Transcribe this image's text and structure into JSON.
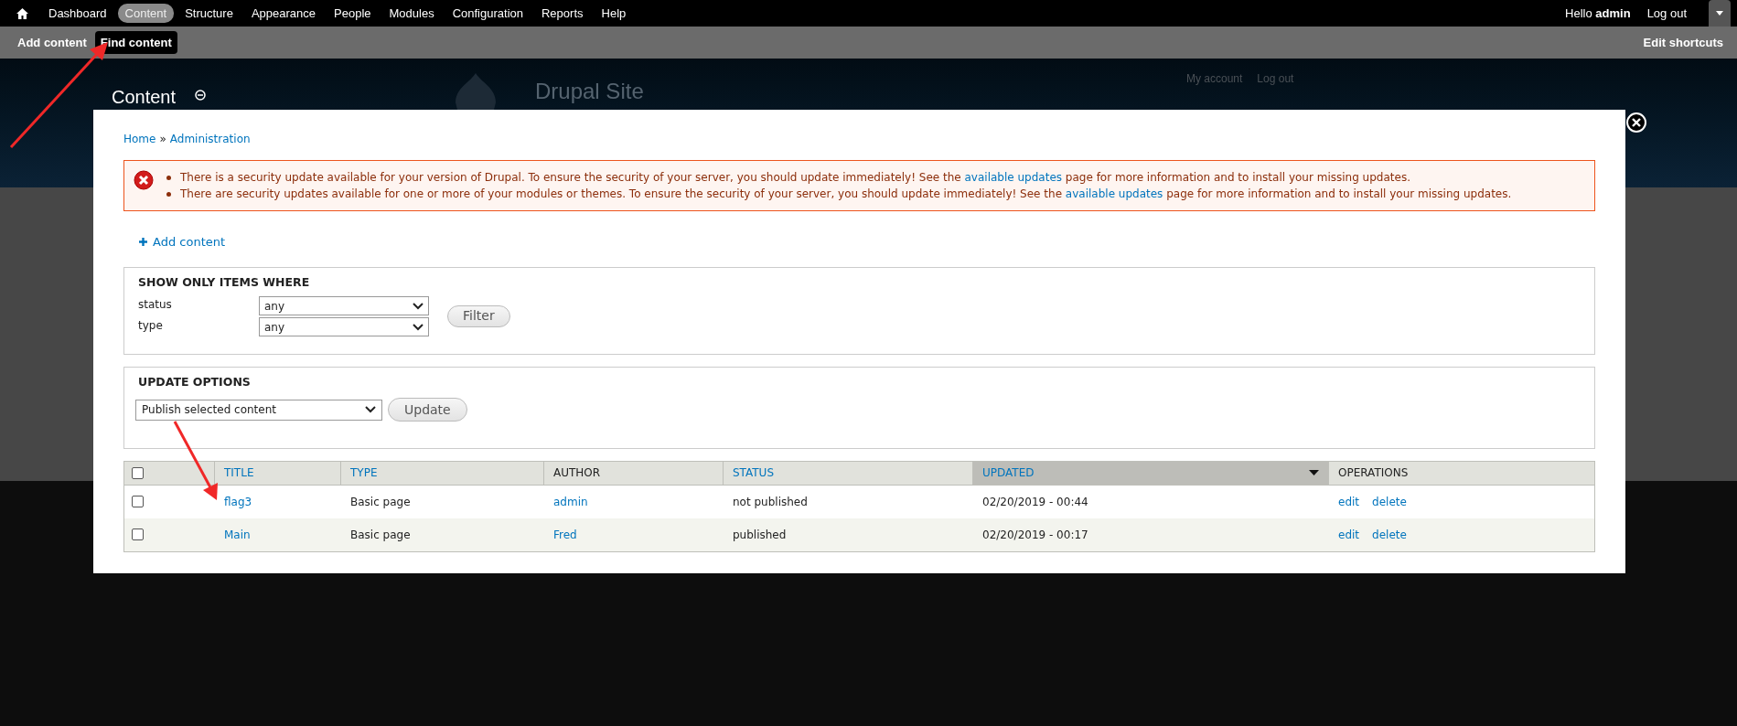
{
  "toolbar": {
    "menu": [
      {
        "label": "Dashboard",
        "selected": false
      },
      {
        "label": "Content",
        "selected": true
      },
      {
        "label": "Structure",
        "selected": false
      },
      {
        "label": "Appearance",
        "selected": false
      },
      {
        "label": "People",
        "selected": false
      },
      {
        "label": "Modules",
        "selected": false
      },
      {
        "label": "Configuration",
        "selected": false
      },
      {
        "label": "Reports",
        "selected": false
      },
      {
        "label": "Help",
        "selected": false
      }
    ],
    "greeting": "Hello **admin**",
    "logout": "Log out"
  },
  "shortcuts": {
    "items": [
      {
        "label": "Add content",
        "selected": false
      },
      {
        "label": "Find content",
        "selected": true
      }
    ],
    "edit": "Edit shortcuts"
  },
  "background_page": {
    "title": "Content",
    "site_name": "Drupal Site",
    "links": [
      "My account",
      "Log out"
    ]
  },
  "overlay": {
    "breadcrumb": [
      "Home",
      "Administration"
    ],
    "separator": "»",
    "messages": [
      {
        "before": "There is a security update available for your version of Drupal. To ensure the security of your server, you should update immediately! See the",
        "link": "available updates",
        "after": "page for more information and to install your missing updates."
      },
      {
        "before": "There are security updates available for one or more of your modules or themes. To ensure the security of your server, you should update immediately! See the",
        "link": "available updates",
        "after": "page for more information and to install your missing updates."
      }
    ],
    "action_link": "Add content",
    "filter": {
      "legend": "SHOW ONLY ITEMS WHERE",
      "fields": [
        {
          "label": "status",
          "value": "any"
        },
        {
          "label": "type",
          "value": "any"
        }
      ],
      "button": "Filter"
    },
    "update_options": {
      "legend": "UPDATE OPTIONS",
      "value": "Publish selected content",
      "button": "Update"
    },
    "table": {
      "select_all_checked": false,
      "columns": [
        {
          "label": "TITLE",
          "sortable": true,
          "selected": false
        },
        {
          "label": "TYPE",
          "sortable": true,
          "selected": false
        },
        {
          "label": "AUTHOR",
          "sortable": false,
          "selected": false
        },
        {
          "label": "STATUS",
          "sortable": true,
          "selected": false
        },
        {
          "label": "UPDATED",
          "sortable": true,
          "selected": true
        },
        {
          "label": "OPERATIONS",
          "sortable": false,
          "selected": false
        }
      ],
      "rows": [
        {
          "checked": false,
          "title": "flag3",
          "type": "Basic page",
          "author": "admin",
          "status": "not published",
          "updated": "02/20/2019 - 00:44",
          "operations": [
            "edit",
            "delete"
          ]
        },
        {
          "checked": false,
          "title": "Main",
          "type": "Basic page",
          "author": "Fred",
          "status": "published",
          "updated": "02/20/2019 - 00:17",
          "operations": [
            "edit",
            "delete"
          ]
        }
      ]
    }
  }
}
